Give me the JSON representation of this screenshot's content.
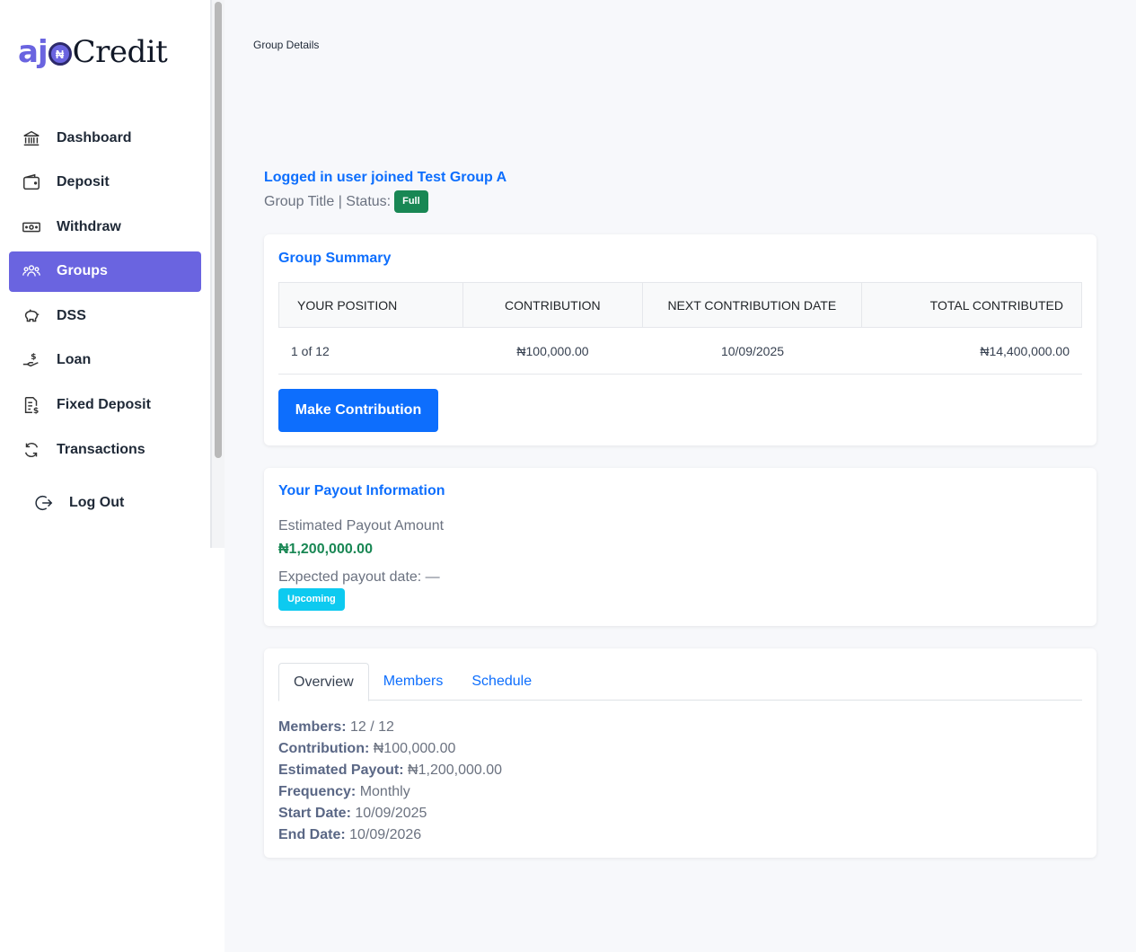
{
  "brand": {
    "part1": "aj",
    "coin": "₦",
    "part2": "Credit"
  },
  "sidebar": {
    "items": [
      {
        "label": "Dashboard",
        "icon": "bank-icon"
      },
      {
        "label": "Deposit",
        "icon": "wallet-icon"
      },
      {
        "label": "Withdraw",
        "icon": "cash-icon"
      },
      {
        "label": "Groups",
        "icon": "people-icon",
        "active": true
      },
      {
        "label": "DSS",
        "icon": "piggy-bank-icon"
      },
      {
        "label": "Loan",
        "icon": "hand-coin-icon"
      },
      {
        "label": "Fixed Deposit",
        "icon": "document-dollar-icon"
      },
      {
        "label": "Transactions",
        "icon": "refresh-icon"
      }
    ],
    "logout_label": "Log Out"
  },
  "breadcrumb": "Group Details",
  "group": {
    "title": "Logged in user joined Test Group A",
    "subtitle": "Group Title | Status:",
    "status": "Full"
  },
  "summary": {
    "title": "Group Summary",
    "headers": [
      "YOUR POSITION",
      "CONTRIBUTION",
      "NEXT CONTRIBUTION DATE",
      "TOTAL CONTRIBUTED"
    ],
    "row": [
      "1 of 12",
      "₦100,000.00",
      "10/09/2025",
      "₦14,400,000.00"
    ],
    "button": "Make Contribution"
  },
  "payout": {
    "title": "Your Payout Information",
    "amount_label": "Estimated Payout Amount",
    "amount": "₦1,200,000.00",
    "date_label": "Expected payout date: —",
    "status": "Upcoming"
  },
  "tabs": [
    "Overview",
    "Members",
    "Schedule"
  ],
  "overview": [
    {
      "label": "Members:",
      "value": " 12 / 12"
    },
    {
      "label": "Contribution:",
      "value": " ₦100,000.00"
    },
    {
      "label": "Estimated Payout:",
      "value": " ₦1,200,000.00"
    },
    {
      "label": "Frequency:",
      "value": " Monthly"
    },
    {
      "label": "Start Date:",
      "value": " 10/09/2025"
    },
    {
      "label": "End Date:",
      "value": " 10/09/2026"
    }
  ],
  "colors": {
    "accent": "#6a64e0",
    "primary": "#0d6efd",
    "success": "#198754",
    "info": "#0dcaf0"
  }
}
